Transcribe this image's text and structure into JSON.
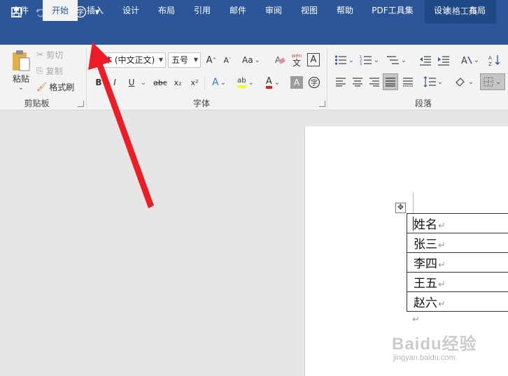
{
  "titlebar": {
    "context_group": "表格工具"
  },
  "qat": {
    "save_icon": "save-icon",
    "undo_icon": "undo-icon",
    "redo_icon": "redo-icon",
    "phonetic_icon": "字",
    "customize_icon": "▾"
  },
  "tabs": [
    {
      "label": "文件"
    },
    {
      "label": "开始"
    },
    {
      "label": "插入"
    },
    {
      "label": "设计"
    },
    {
      "label": "布局"
    },
    {
      "label": "引用"
    },
    {
      "label": "邮件"
    },
    {
      "label": "审阅"
    },
    {
      "label": "视图"
    },
    {
      "label": "帮助"
    },
    {
      "label": "PDF工具集"
    },
    {
      "label": "设计"
    },
    {
      "label": "布局"
    }
  ],
  "clipboard": {
    "paste_label": "粘贴",
    "cut_label": "剪切",
    "copy_label": "复制",
    "format_painter_label": "格式刷",
    "group_label": "剪贴板"
  },
  "font": {
    "font_name": "宋体 (中文正文)",
    "font_size": "五号",
    "group_label": "字体",
    "grow": "A",
    "shrink": "A",
    "case": "Aa",
    "phonetic_top": "wén",
    "phonetic_bottom": "文",
    "border_char": "A",
    "bold": "B",
    "italic": "I",
    "underline": "U",
    "strike": "abc",
    "sub": "x₂",
    "sup": "x²",
    "effects": "A",
    "highlight": "ab",
    "font_color": "A",
    "shading": "A",
    "enclose": "字"
  },
  "paragraph": {
    "group_label": "段落"
  },
  "document": {
    "table_rows": [
      {
        "text": "姓名"
      },
      {
        "text": "张三"
      },
      {
        "text": "李四"
      },
      {
        "text": "王五"
      },
      {
        "text": "赵六"
      }
    ],
    "para_mark": "↵"
  },
  "watermark": {
    "main": "Baidu经验",
    "sub": "jingyan.baidu.com"
  },
  "colors": {
    "brand": "#2b579a",
    "ribbon_bg": "#f3f3f3",
    "arrow": "#ee1c25",
    "highlight_yellow": "#ffff00",
    "font_red": "#e02020"
  }
}
